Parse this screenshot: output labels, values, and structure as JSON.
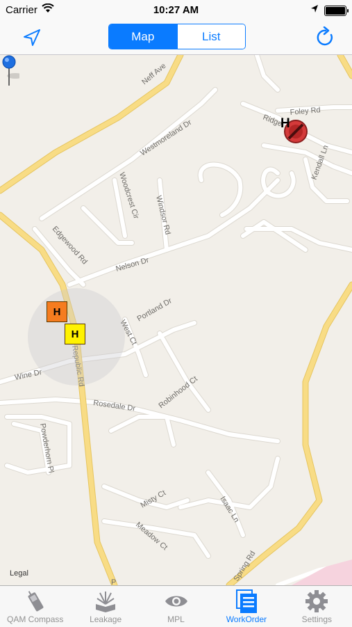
{
  "status_bar": {
    "carrier": "Carrier",
    "time": "10:27 AM"
  },
  "nav": {
    "segments": [
      {
        "label": "Map",
        "selected": true
      },
      {
        "label": "List",
        "selected": false
      }
    ]
  },
  "map": {
    "streets": {
      "neff": "Neff Ave",
      "westmoreland": "Westmoreland Dr",
      "woodcrest": "Woodcrest Cir",
      "windsor": "Windsor Rd",
      "edgewood": "Edgewood Rd",
      "nelson": "Nelson Dr",
      "portland": "Portland Dr",
      "west": "West Ct",
      "wine": "Wine Dr",
      "republic": "Republic Rd",
      "rosedale": "Rosedale Dr",
      "robinhood": "Robinhood Ct",
      "powderhorn": "Powderhorn Pl",
      "misty": "Misty Ct",
      "meadow": "Meadow Ct",
      "isaac": "Isaac Ln",
      "spring": "Spring Rd",
      "foley": "Foley Rd",
      "ridge": "Ridge",
      "kendall": "Kendall Ln",
      "p": "P"
    },
    "markers": {
      "orange_label": "H",
      "yellow_label": "H",
      "red_label": "H"
    },
    "legal": "Legal"
  },
  "tabs": [
    {
      "label": "QAM Compass",
      "icon": "phone-icon",
      "active": false
    },
    {
      "label": "Leakage",
      "icon": "leakage-icon",
      "active": false
    },
    {
      "label": "MPL",
      "icon": "eye-icon",
      "active": false
    },
    {
      "label": "WorkOrder",
      "icon": "workorder-icon",
      "active": true
    },
    {
      "label": "Settings",
      "icon": "gear-icon",
      "active": false
    }
  ],
  "colors": {
    "accent": "#0a7bff",
    "major_road": "#f5d77a",
    "minor_road": "#ffffff",
    "land": "#f2efe9"
  }
}
